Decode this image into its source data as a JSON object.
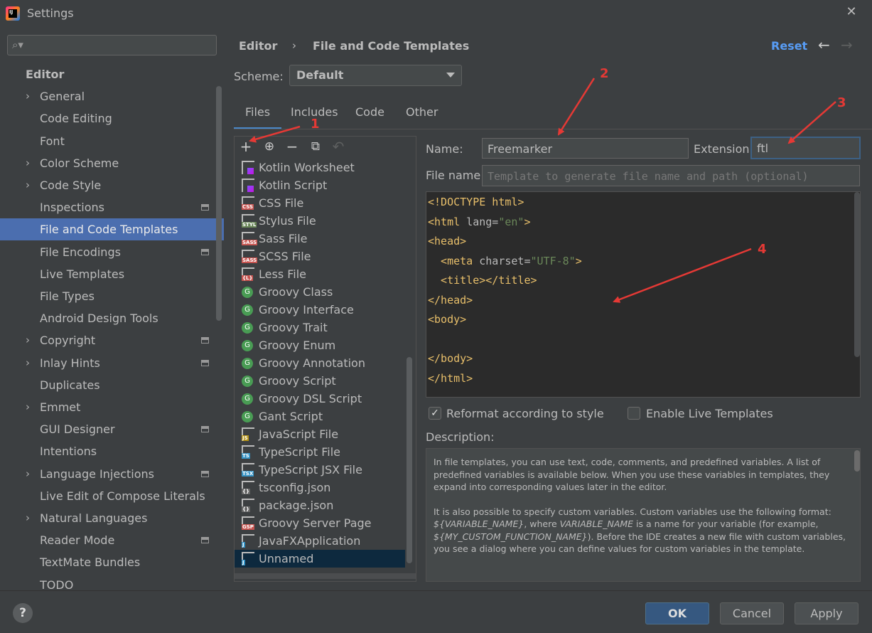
{
  "window": {
    "title": "Settings",
    "icon_text": "IJ"
  },
  "sidebar": {
    "search_placeholder": "",
    "items": [
      {
        "label": "Editor",
        "arrow": false,
        "badge": false,
        "bold": true
      },
      {
        "label": "General",
        "arrow": true,
        "badge": false
      },
      {
        "label": "Code Editing",
        "arrow": false,
        "badge": false
      },
      {
        "label": "Font",
        "arrow": false,
        "badge": false
      },
      {
        "label": "Color Scheme",
        "arrow": true,
        "badge": false
      },
      {
        "label": "Code Style",
        "arrow": true,
        "badge": false
      },
      {
        "label": "Inspections",
        "arrow": false,
        "badge": true
      },
      {
        "label": "File and Code Templates",
        "arrow": false,
        "badge": false,
        "selected": true
      },
      {
        "label": "File Encodings",
        "arrow": false,
        "badge": true
      },
      {
        "label": "Live Templates",
        "arrow": false,
        "badge": false
      },
      {
        "label": "File Types",
        "arrow": false,
        "badge": false
      },
      {
        "label": "Android Design Tools",
        "arrow": false,
        "badge": false
      },
      {
        "label": "Copyright",
        "arrow": true,
        "badge": true
      },
      {
        "label": "Inlay Hints",
        "arrow": true,
        "badge": true
      },
      {
        "label": "Duplicates",
        "arrow": false,
        "badge": false
      },
      {
        "label": "Emmet",
        "arrow": true,
        "badge": false
      },
      {
        "label": "GUI Designer",
        "arrow": false,
        "badge": true
      },
      {
        "label": "Intentions",
        "arrow": false,
        "badge": false
      },
      {
        "label": "Language Injections",
        "arrow": true,
        "badge": true
      },
      {
        "label": "Live Edit of Compose Literals",
        "arrow": false,
        "badge": false
      },
      {
        "label": "Natural Languages",
        "arrow": true,
        "badge": false
      },
      {
        "label": "Reader Mode",
        "arrow": false,
        "badge": true
      },
      {
        "label": "TextMate Bundles",
        "arrow": false,
        "badge": false
      },
      {
        "label": "TODO",
        "arrow": false,
        "badge": false
      }
    ]
  },
  "header": {
    "breadcrumb": [
      "Editor",
      "File and Code Templates"
    ],
    "breadcrumb_sep": "›",
    "reset": "Reset",
    "back_icon": "←",
    "forward_icon": "→"
  },
  "scheme": {
    "label": "Scheme:",
    "value": "Default"
  },
  "tabs": [
    "Files",
    "Includes",
    "Code",
    "Other"
  ],
  "toolbar": {
    "add": "+",
    "add_child": "⊕",
    "remove": "−",
    "copy": "⧉",
    "reset": "↶"
  },
  "files": [
    {
      "name": "Kotlin Worksheet",
      "icon": "kotlin",
      "label": ""
    },
    {
      "name": "Kotlin Script",
      "icon": "kotlin",
      "label": ""
    },
    {
      "name": "CSS File",
      "icon": "doc",
      "label": "CSS",
      "color": "#c75450"
    },
    {
      "name": "Stylus File",
      "icon": "doc",
      "label": "STYL",
      "color": "#6a8759"
    },
    {
      "name": "Sass File",
      "icon": "doc",
      "label": "SASS",
      "color": "#c75450"
    },
    {
      "name": "SCSS File",
      "icon": "doc",
      "label": "SASS",
      "color": "#c75450"
    },
    {
      "name": "Less File",
      "icon": "doc",
      "label": "{L}",
      "color": "#c75450"
    },
    {
      "name": "Groovy Class",
      "icon": "groovy",
      "label": "G"
    },
    {
      "name": "Groovy Interface",
      "icon": "groovy",
      "label": "G"
    },
    {
      "name": "Groovy Trait",
      "icon": "groovy",
      "label": "G"
    },
    {
      "name": "Groovy Enum",
      "icon": "groovy",
      "label": "G"
    },
    {
      "name": "Groovy Annotation",
      "icon": "groovy",
      "label": "G"
    },
    {
      "name": "Groovy Script",
      "icon": "groovy",
      "label": "G"
    },
    {
      "name": "Groovy DSL Script",
      "icon": "groovy",
      "label": "G"
    },
    {
      "name": "Gant Script",
      "icon": "groovy",
      "label": "G"
    },
    {
      "name": "JavaScript File",
      "icon": "doc",
      "label": "JS",
      "color": "#b59418"
    },
    {
      "name": "TypeScript File",
      "icon": "doc",
      "label": "TS",
      "color": "#3592c4"
    },
    {
      "name": "TypeScript JSX File",
      "icon": "doc",
      "label": "TSX",
      "color": "#3592c4"
    },
    {
      "name": "tsconfig.json",
      "icon": "doc",
      "label": "{}",
      "color": "#666"
    },
    {
      "name": "package.json",
      "icon": "doc",
      "label": "{}",
      "color": "#666"
    },
    {
      "name": "Groovy Server Page",
      "icon": "doc",
      "label": "GSP",
      "color": "#c75450"
    },
    {
      "name": "JavaFXApplication",
      "icon": "doc",
      "label": "J",
      "color": "#3592c4"
    },
    {
      "name": "Unnamed",
      "icon": "doc",
      "label": "J",
      "color": "#3592c4",
      "selected": true
    }
  ],
  "form": {
    "name_label": "Name:",
    "name_value": "Freemarker",
    "ext_label": "Extension:",
    "ext_value": "ftl",
    "filename_label": "File name:",
    "filename_placeholder": "Template to generate file name and path (optional)"
  },
  "code_lines": [
    [
      [
        "t",
        "<!DOCTYPE html>"
      ]
    ],
    [
      [
        "t",
        "<html "
      ],
      [
        "a",
        "lang="
      ],
      [
        "s",
        "\"en\""
      ],
      [
        "t",
        ">"
      ]
    ],
    [
      [
        "t",
        "<head>"
      ]
    ],
    [
      [
        "t",
        "  <meta "
      ],
      [
        "a",
        "charset="
      ],
      [
        "s",
        "\"UTF-8\""
      ],
      [
        "t",
        ">"
      ]
    ],
    [
      [
        "t",
        "  <title></title>"
      ]
    ],
    [
      [
        "t",
        "</head>"
      ]
    ],
    [
      [
        "t",
        "<body>"
      ]
    ],
    [
      [
        "t",
        ""
      ]
    ],
    [
      [
        "t",
        "</body>"
      ]
    ],
    [
      [
        "t",
        "</html>"
      ]
    ]
  ],
  "options": {
    "reformat_label": "Reformat according to style",
    "reformat_checked": true,
    "live_label": "Enable Live Templates",
    "live_checked": false
  },
  "description": {
    "label": "Description:",
    "p1": "In file templates, you can use text, code, comments, and predefined variables. A list of predefined variables is available below. When you use these variables in templates, they expand into corresponding values later in the editor.",
    "p2_a": "It is also possible to specify custom variables. Custom variables use the following format: ",
    "p2_var1": "${VARIABLE_NAME}",
    "p2_b": ", where ",
    "p2_var2": "VARIABLE_NAME",
    "p2_c": " is a name for your variable (for example, ",
    "p2_var3": "${MY_CUSTOM_FUNCTION_NAME}",
    "p2_d": "). Before the IDE creates a new file with custom variables, you see a dialog where you can define values for custom variables in the template."
  },
  "buttons": {
    "help": "?",
    "ok": "OK",
    "cancel": "Cancel",
    "apply": "Apply"
  },
  "annotations": [
    "1",
    "2",
    "3",
    "4"
  ],
  "colors": {
    "accent": "#4b6eaf",
    "link": "#589df6",
    "annotation": "#e53935"
  }
}
